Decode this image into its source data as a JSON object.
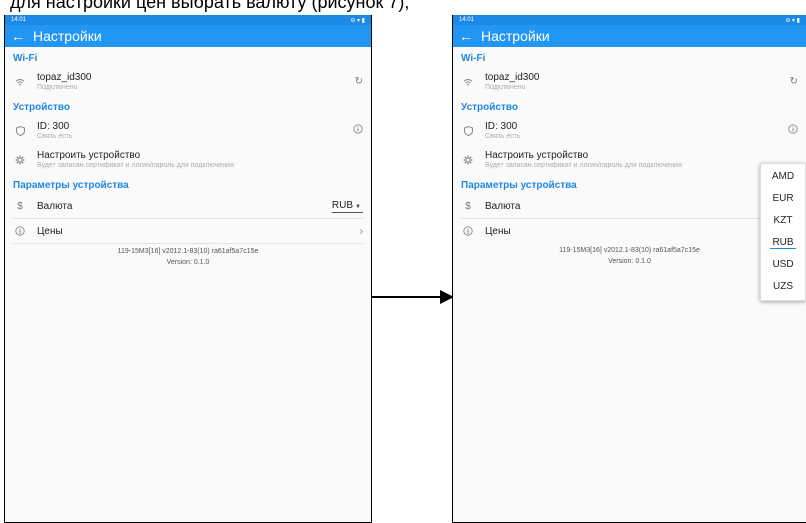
{
  "caption": "для настройки цен выбрать валюту (рисунок 7);",
  "status": {
    "time": "14:01",
    "icons_right": "⊖ ▾ ▮"
  },
  "app": {
    "back": "←",
    "title": "Настройки"
  },
  "wifi": {
    "header": "Wi-Fi",
    "name": "topaz_id300",
    "status": "Подключено",
    "refresh_icon": "↻"
  },
  "device": {
    "header": "Устройство",
    "id": "ID: 300",
    "link_status": "Связь есть",
    "configure_title": "Настроить устройство",
    "configure_desc": "Будет записан сертификат и логин/пароль для подключения"
  },
  "params": {
    "header": "Параметры устройства",
    "currency_label": "Валюта",
    "currency_value": "RUB",
    "prices_label": "Цены"
  },
  "footer": {
    "build": "119-15M3[16] v2012.1-83(10) ra61af5a7c15e",
    "version": "Version: 0.1.0"
  },
  "currency_options": [
    "AMD",
    "EUR",
    "KZT",
    "RUB",
    "USD",
    "UZS"
  ],
  "colors": {
    "primary": "#2196f3",
    "accent": "#1e88e5"
  }
}
